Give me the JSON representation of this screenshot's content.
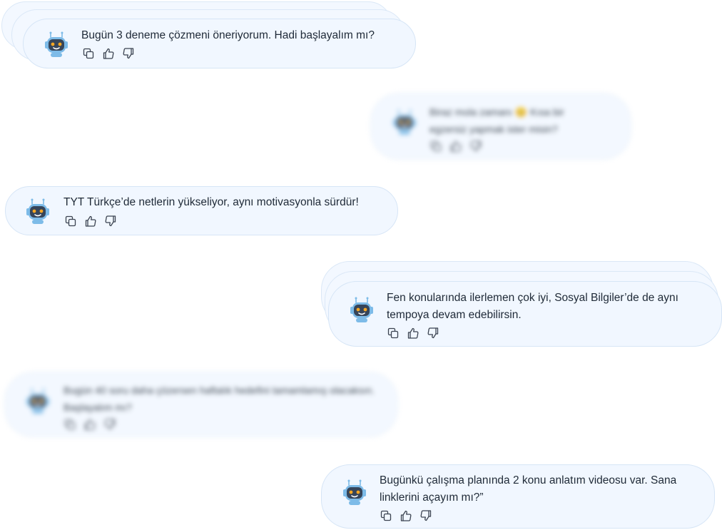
{
  "messages": [
    {
      "text": "Bugün 3 deneme çözmeni öneriyorum. Hadi başlayalım mı?",
      "blurred": false,
      "side": "left"
    },
    {
      "text": "Biraz mola zamanı 😊 Kısa bir egzersiz yapmak ister misin?",
      "blurred": true,
      "side": "right"
    },
    {
      "text": "TYT Türkçe’de netlerin yükseliyor, aynı motivasyonla sürdür!",
      "blurred": false,
      "side": "left"
    },
    {
      "text": "Fen konularında ilerlemen çok iyi, Sosyal Bilgiler’de de aynı tempoya devam edebilirsin.",
      "blurred": false,
      "side": "right"
    },
    {
      "text": "Bugün 40 soru daha çözersen haftalık hedefini tamamlamış olacaksın. Başlayalım mı?",
      "blurred": true,
      "side": "left"
    },
    {
      "text": "Bugünkü çalışma planında 2 konu anlatım videosu var. Sana linklerini açayım mı?”",
      "blurred": false,
      "side": "right"
    }
  ],
  "actions": {
    "copy_icon": "copy-icon",
    "like_icon": "thumbs-up-icon",
    "dislike_icon": "thumbs-down-icon"
  },
  "colors": {
    "bubble_bg": "#f1f7ff",
    "bubble_border": "#d6e5f6",
    "text": "#1f2a37",
    "icon": "#3b4350",
    "robot_head": "#36455a",
    "robot_ear": "#7dbbe8",
    "robot_eye": "#f5a623"
  }
}
